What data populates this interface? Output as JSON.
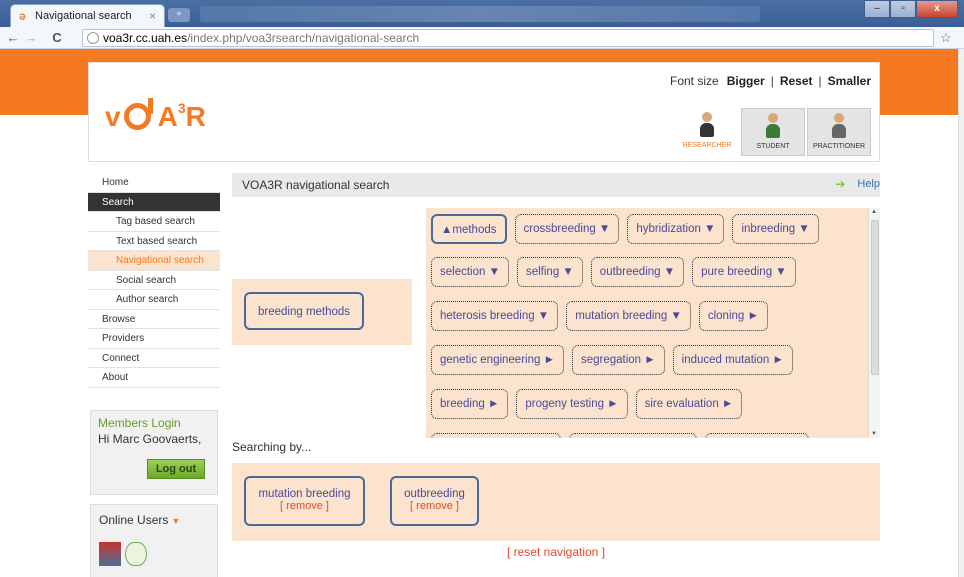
{
  "browser": {
    "tab_title": "Navigational search",
    "tab_close": "×",
    "newtab": "+",
    "url_host": "voa3r.cc.uah.es",
    "url_path": "/index.php/voa3rsearch/navigational-search",
    "back": "←",
    "forward": "→",
    "reload": "C",
    "bookmark": "☆",
    "win_min": "–",
    "win_max": "▫",
    "win_close": "x"
  },
  "header": {
    "logo": {
      "v": "v",
      "a": "A",
      "sup": "3",
      "r": "R"
    },
    "font_size_label": "Font size",
    "bigger": "Bigger",
    "reset": "Reset",
    "smaller": "Smaller",
    "sep": "|",
    "roles": [
      {
        "label": "RESEARCHER"
      },
      {
        "label": "STUDENT"
      },
      {
        "label": "PRACTITIONER"
      }
    ]
  },
  "sidebar": {
    "items": [
      {
        "label": "Home"
      },
      {
        "label": "Search"
      },
      {
        "label": "Tag based search"
      },
      {
        "label": "Text based search"
      },
      {
        "label": "Navigational search"
      },
      {
        "label": "Social search"
      },
      {
        "label": "Author search"
      },
      {
        "label": "Browse"
      },
      {
        "label": "Providers"
      },
      {
        "label": "Connect"
      },
      {
        "label": "About"
      }
    ],
    "login": {
      "title": "Members Login",
      "greeting": "Hi Marc Goovaerts,",
      "logout": "Log out"
    },
    "online": {
      "title": "Online Users",
      "caret": "▼"
    }
  },
  "main": {
    "title": "VOA3R navigational search",
    "help": "Help",
    "help_arrow": "➔",
    "root_tag": "breeding methods",
    "tags": [
      "▲methods",
      "crossbreeding ▼",
      "hybridization ▼",
      "inbreeding ▼",
      "selection ▼",
      "selfing ▼",
      "outbreeding ▼",
      "pure breeding ▼",
      "heterosis breeding ▼",
      "mutation breeding ▼",
      "cloning ►",
      "genetic engineering ►",
      "segregation ►",
      "induced mutation ►",
      "breeding ►",
      "progeny testing ►",
      "sire evaluation ►"
    ],
    "scroll_up": "▲",
    "scroll_down": "▼",
    "searching_by": "Searching by...",
    "selected": [
      {
        "name": "mutation breeding",
        "remove": "[ remove ]"
      },
      {
        "name": "outbreeding",
        "remove": "[ remove ]"
      }
    ],
    "reset_nav": "[ reset navigation ]"
  }
}
